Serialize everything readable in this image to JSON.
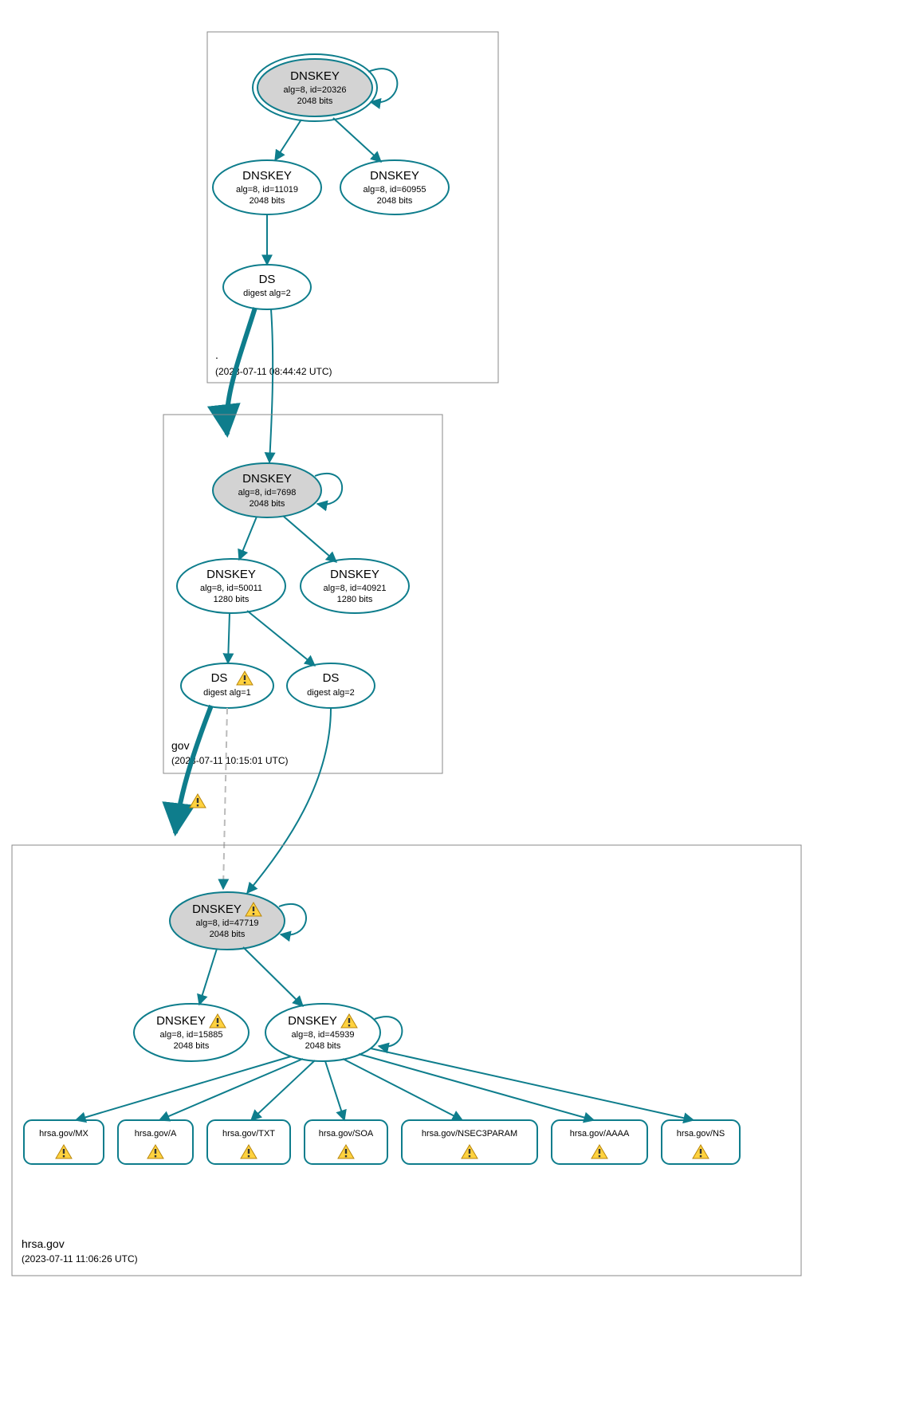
{
  "colors": {
    "stroke": "#0e7d8c",
    "fill_sep": "#d3d3d3"
  },
  "zones": {
    "root": {
      "label": ".",
      "timestamp": "(2023-07-11 08:44:42 UTC)"
    },
    "gov": {
      "label": "gov",
      "timestamp": "(2023-07-11 10:15:01 UTC)"
    },
    "hrsa": {
      "label": "hrsa.gov",
      "timestamp": "(2023-07-11 11:06:26 UTC)"
    }
  },
  "nodes": {
    "root_ksk": {
      "title": "DNSKEY",
      "l2": "alg=8, id=20326",
      "l3": "2048 bits"
    },
    "root_zsk1": {
      "title": "DNSKEY",
      "l2": "alg=8, id=11019",
      "l3": "2048 bits"
    },
    "root_zsk2": {
      "title": "DNSKEY",
      "l2": "alg=8, id=60955",
      "l3": "2048 bits"
    },
    "root_ds": {
      "title": "DS",
      "l2": "digest alg=2"
    },
    "gov_ksk": {
      "title": "DNSKEY",
      "l2": "alg=8, id=7698",
      "l3": "2048 bits"
    },
    "gov_zsk1": {
      "title": "DNSKEY",
      "l2": "alg=8, id=50011",
      "l3": "1280 bits"
    },
    "gov_zsk2": {
      "title": "DNSKEY",
      "l2": "alg=8, id=40921",
      "l3": "1280 bits"
    },
    "gov_ds1": {
      "title": "DS",
      "l2": "digest alg=1",
      "warn": true
    },
    "gov_ds2": {
      "title": "DS",
      "l2": "digest alg=2"
    },
    "hrsa_ksk": {
      "title": "DNSKEY",
      "l2": "alg=8, id=47719",
      "l3": "2048 bits",
      "warn": true
    },
    "hrsa_zsk1": {
      "title": "DNSKEY",
      "l2": "alg=8, id=15885",
      "l3": "2048 bits",
      "warn": true
    },
    "hrsa_zsk2": {
      "title": "DNSKEY",
      "l2": "alg=8, id=45939",
      "l3": "2048 bits",
      "warn": true
    }
  },
  "rrsets": {
    "mx": {
      "label": "hrsa.gov/MX"
    },
    "a": {
      "label": "hrsa.gov/A"
    },
    "txt": {
      "label": "hrsa.gov/TXT"
    },
    "soa": {
      "label": "hrsa.gov/SOA"
    },
    "nsec3": {
      "label": "hrsa.gov/NSEC3PARAM"
    },
    "aaaa": {
      "label": "hrsa.gov/AAAA"
    },
    "ns": {
      "label": "hrsa.gov/NS"
    }
  },
  "floating_warn": true
}
